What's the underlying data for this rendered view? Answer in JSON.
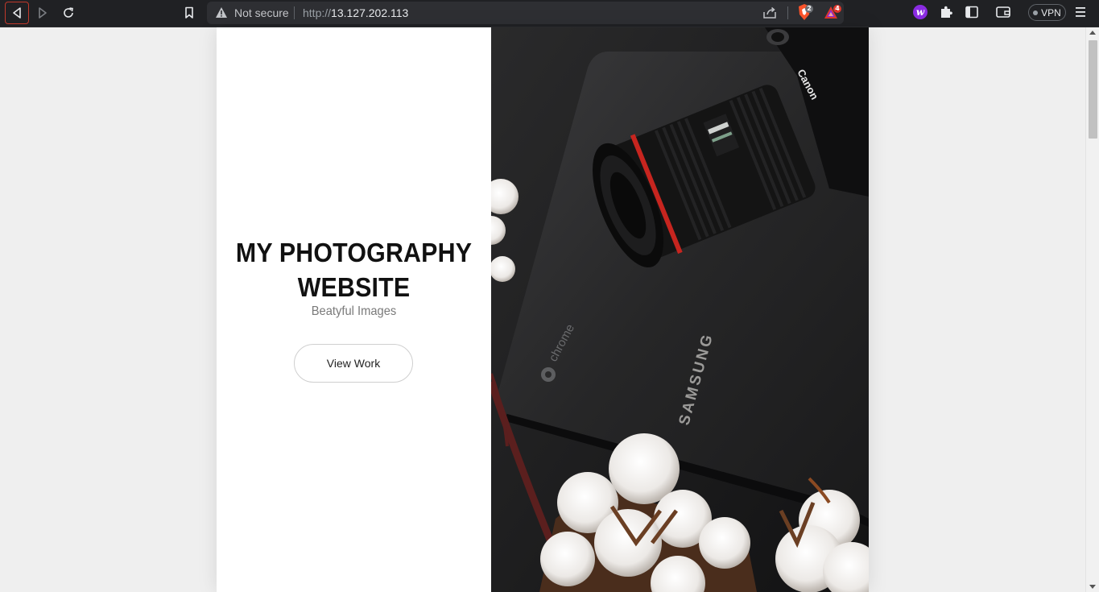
{
  "browser": {
    "security_label": "Not secure",
    "url_scheme": "http://",
    "url_host": "13.127.202.113",
    "shield_badge": "2",
    "rewards_badge": "4",
    "vpn_label": "VPN",
    "extension_letter": "w"
  },
  "hero": {
    "title_line1": "MY PHOTOGRAPHY",
    "title_line2": "WEBSITE",
    "subtitle": "Beatyful Images",
    "button_label": "View Work",
    "photo_alt": "Camera lens resting on a Samsung Chromebook with cotton flowers"
  },
  "photo_text": {
    "laptop_os": "chrome",
    "laptop_brand": "SAMSUNG",
    "camera_brand": "Canon"
  },
  "colors": {
    "accent_red": "#c0392b",
    "toolbar_bg": "#202124",
    "page_bg": "#efefef"
  }
}
